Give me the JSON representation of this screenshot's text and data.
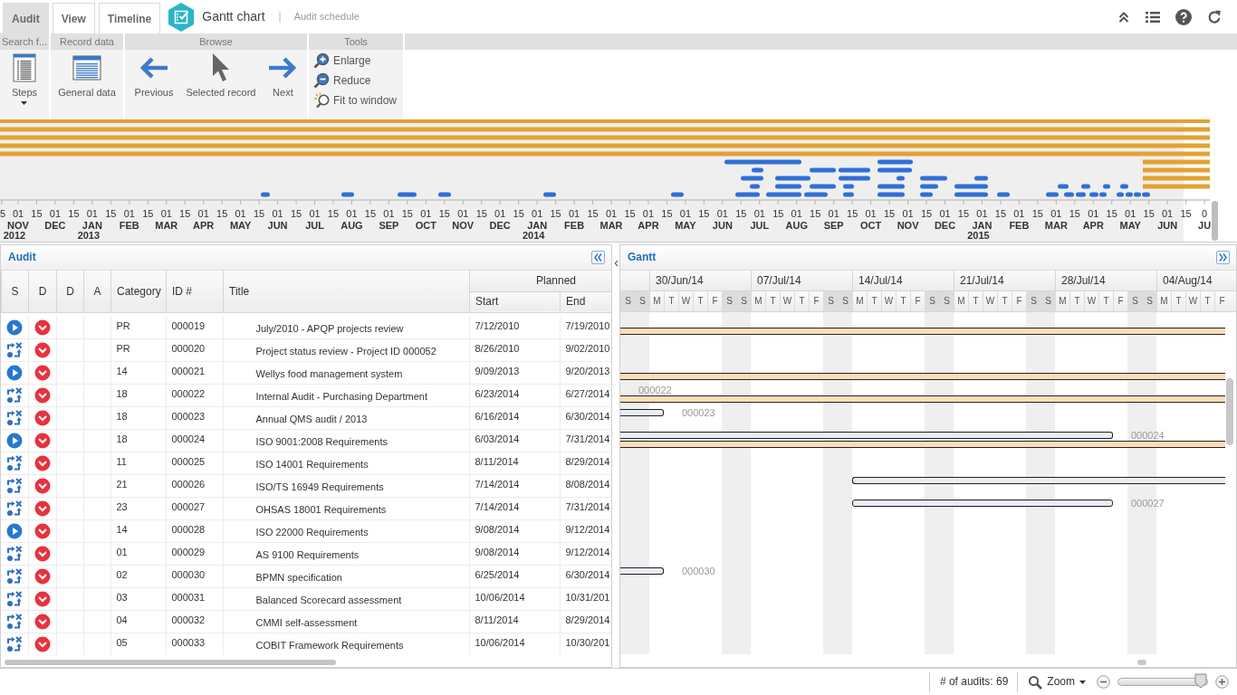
{
  "tabs": [
    {
      "label": "Audit",
      "selected": true
    },
    {
      "label": "View",
      "selected": false
    },
    {
      "label": "Timeline",
      "selected": false
    }
  ],
  "header": {
    "title": "Gantt chart",
    "separator": "|",
    "subtitle": "Audit schedule"
  },
  "ribbon": {
    "groups": [
      {
        "title": "Search f...",
        "items": [
          {
            "label": "Steps",
            "kind": "large",
            "dropdown": true
          }
        ]
      },
      {
        "title": "Record data",
        "items": [
          {
            "label": "General data",
            "kind": "large"
          }
        ]
      },
      {
        "title": "Browse",
        "items": [
          {
            "label": "Previous",
            "kind": "large"
          },
          {
            "label": "Selected record",
            "kind": "large"
          },
          {
            "label": "Next",
            "kind": "large"
          }
        ]
      },
      {
        "title": "Tools",
        "items": [
          {
            "label": "Enlarge",
            "kind": "small"
          },
          {
            "label": "Reduce",
            "kind": "small"
          },
          {
            "label": "Fit to window",
            "kind": "small"
          }
        ]
      }
    ]
  },
  "overview": {
    "ticks": [
      "5",
      "01",
      "15",
      "01",
      "15",
      "01",
      "15",
      "01",
      "15",
      "01",
      "15",
      "01",
      "15",
      "01",
      "15",
      "01",
      "15",
      "01",
      "15",
      "01",
      "15",
      "01",
      "15",
      "01",
      "15",
      "01",
      "15",
      "01",
      "15",
      "01",
      "15",
      "01",
      "15",
      "01",
      "15",
      "01",
      "15",
      "01",
      "15",
      "01",
      "15",
      "01",
      "15",
      "01",
      "15",
      "01",
      "15",
      "01",
      "15",
      "01",
      "15",
      "01",
      "15",
      "01",
      "15",
      "01",
      "15",
      "01",
      "15",
      "01",
      "15",
      "01",
      "15",
      "01",
      "15",
      "0"
    ],
    "months": [
      {
        "label": "NOV",
        "year": "2012"
      },
      {
        "label": "DEC"
      },
      {
        "label": "JAN",
        "year": "2013"
      },
      {
        "label": "FEB"
      },
      {
        "label": "MAR"
      },
      {
        "label": "APR"
      },
      {
        "label": "MAY"
      },
      {
        "label": "JUN"
      },
      {
        "label": "JUL"
      },
      {
        "label": "AUG"
      },
      {
        "label": "SEP"
      },
      {
        "label": "OCT"
      },
      {
        "label": "NOV"
      },
      {
        "label": "DEC"
      },
      {
        "label": "JAN",
        "year": "2014"
      },
      {
        "label": "FEB"
      },
      {
        "label": "MAR"
      },
      {
        "label": "APR"
      },
      {
        "label": "MAY"
      },
      {
        "label": "JUN"
      },
      {
        "label": "JUL"
      },
      {
        "label": "AUG"
      },
      {
        "label": "SEP"
      },
      {
        "label": "OCT"
      },
      {
        "label": "NOV"
      },
      {
        "label": "DEC"
      },
      {
        "label": "JAN",
        "year": "2015"
      },
      {
        "label": "FEB"
      },
      {
        "label": "MAR"
      },
      {
        "label": "APR"
      },
      {
        "label": "MAY"
      },
      {
        "label": "JUN"
      },
      {
        "label": "JU"
      }
    ]
  },
  "audit": {
    "title": "Audit",
    "columns": [
      "S",
      "D",
      "D",
      "A",
      "Category",
      "ID #",
      "Title"
    ],
    "column_group": {
      "label": "Planned",
      "columns": [
        "Start",
        "End"
      ]
    },
    "rows": [
      {
        "kind": "play",
        "category": "PR",
        "id": "000019",
        "title": "July/2010 - APQP projects review",
        "start": "7/12/2010",
        "end": "7/19/2010"
      },
      {
        "kind": "workflow",
        "category": "PR",
        "id": "000020",
        "title": "Project status review - Project ID 000052",
        "start": "8/26/2010",
        "end": "9/02/2010"
      },
      {
        "kind": "play",
        "category": "14",
        "id": "000021",
        "title": "Wellys food management system",
        "start": "9/09/2013",
        "end": "9/20/2013"
      },
      {
        "kind": "workflow",
        "category": "18",
        "id": "000022",
        "title": "Internal Audit - Purchasing Department",
        "start": "6/23/2014",
        "end": "6/27/2014"
      },
      {
        "kind": "workflow",
        "category": "18",
        "id": "000023",
        "title": "Annual QMS audit / 2013",
        "start": "6/16/2014",
        "end": "6/30/2014"
      },
      {
        "kind": "play",
        "category": "18",
        "id": "000024",
        "title": "ISO 9001:2008 Requirements",
        "start": "6/03/2014",
        "end": "7/31/2014"
      },
      {
        "kind": "workflow",
        "category": "11",
        "id": "000025",
        "title": "ISO 14001 Requirements",
        "start": "8/11/2014",
        "end": "8/29/2014"
      },
      {
        "kind": "workflow",
        "category": "21",
        "id": "000026",
        "title": "ISO/TS 16949 Requirements",
        "start": "7/14/2014",
        "end": "8/08/2014"
      },
      {
        "kind": "workflow",
        "category": "23",
        "id": "000027",
        "title": "OHSAS 18001 Requirements",
        "start": "7/14/2014",
        "end": "7/31/2014"
      },
      {
        "kind": "play",
        "category": "14",
        "id": "000028",
        "title": "ISO 22000 Requirements",
        "start": "9/08/2014",
        "end": "9/12/2014"
      },
      {
        "kind": "workflow",
        "category": "01",
        "id": "000029",
        "title": "AS 9100 Requirements",
        "start": "9/08/2014",
        "end": "9/12/2014"
      },
      {
        "kind": "workflow",
        "category": "02",
        "id": "000030",
        "title": "BPMN specification",
        "start": "6/25/2014",
        "end": "6/30/2014"
      },
      {
        "kind": "workflow",
        "category": "03",
        "id": "000031",
        "title": "Balanced Scorecard assessment",
        "start": "10/06/2014",
        "end": "10/31/201"
      },
      {
        "kind": "workflow",
        "category": "04",
        "id": "000032",
        "title": "CMMI self-assessment",
        "start": "8/11/2014",
        "end": "8/29/2014"
      },
      {
        "kind": "workflow",
        "category": "05",
        "id": "000033",
        "title": "COBIT Framework Requirements",
        "start": "10/06/2014",
        "end": "10/30/201"
      }
    ]
  },
  "gantt": {
    "title": "Gantt",
    "weeks": [
      "30/Jun/14",
      "07/Jul/14",
      "14/Jul/14",
      "21/Jul/14",
      "28/Jul/14",
      "04/Aug/14"
    ],
    "days": [
      {
        "label": "S",
        "weekend": true
      },
      {
        "label": "S",
        "weekend": true
      },
      {
        "label": "M",
        "weekend": false
      },
      {
        "label": "T",
        "weekend": false
      },
      {
        "label": "W",
        "weekend": false
      },
      {
        "label": "T",
        "weekend": false
      },
      {
        "label": "F",
        "weekend": false
      },
      {
        "label": "S",
        "weekend": true
      },
      {
        "label": "S",
        "weekend": true
      },
      {
        "label": "M",
        "weekend": false
      },
      {
        "label": "T",
        "weekend": false
      },
      {
        "label": "W",
        "weekend": false
      },
      {
        "label": "T",
        "weekend": false
      },
      {
        "label": "F",
        "weekend": false
      },
      {
        "label": "S",
        "weekend": true
      },
      {
        "label": "S",
        "weekend": true
      },
      {
        "label": "M",
        "weekend": false
      },
      {
        "label": "T",
        "weekend": false
      },
      {
        "label": "W",
        "weekend": false
      },
      {
        "label": "T",
        "weekend": false
      },
      {
        "label": "F",
        "weekend": false
      },
      {
        "label": "S",
        "weekend": true
      },
      {
        "label": "S",
        "weekend": true
      },
      {
        "label": "M",
        "weekend": false
      },
      {
        "label": "T",
        "weekend": false
      },
      {
        "label": "W",
        "weekend": false
      },
      {
        "label": "T",
        "weekend": false
      },
      {
        "label": "F",
        "weekend": false
      },
      {
        "label": "S",
        "weekend": true
      },
      {
        "label": "S",
        "weekend": true
      },
      {
        "label": "M",
        "weekend": false
      },
      {
        "label": "T",
        "weekend": false
      },
      {
        "label": "W",
        "weekend": false
      },
      {
        "label": "T",
        "weekend": false
      },
      {
        "label": "F",
        "weekend": false
      },
      {
        "label": "S",
        "weekend": true
      },
      {
        "label": "S",
        "weekend": true
      },
      {
        "label": "M",
        "weekend": false
      },
      {
        "label": "T",
        "weekend": false
      },
      {
        "label": "W",
        "weekend": false
      },
      {
        "label": "T",
        "weekend": false
      },
      {
        "label": "F",
        "weekend": false
      }
    ],
    "rows": [
      {
        "actual_bar": true
      },
      {
        "actual_bar": false
      },
      {
        "actual_bar": true
      },
      {
        "actual_bar": true,
        "label": "000022"
      },
      {
        "actual_bar": false,
        "label": "000023"
      },
      {
        "actual_bar": true,
        "label": "000024"
      },
      {
        "actual_bar": false
      },
      {
        "actual_bar": false
      },
      {
        "actual_bar": false,
        "label": "000027"
      },
      {
        "actual_bar": false
      },
      {
        "actual_bar": false
      },
      {
        "actual_bar": false,
        "label": "000030"
      },
      {
        "actual_bar": false
      },
      {
        "actual_bar": false
      },
      {
        "actual_bar": false
      }
    ]
  },
  "status_bar": {
    "count": "# of audits: 69",
    "zoom": {
      "label": "Zoom",
      "level": 0.93
    }
  }
}
